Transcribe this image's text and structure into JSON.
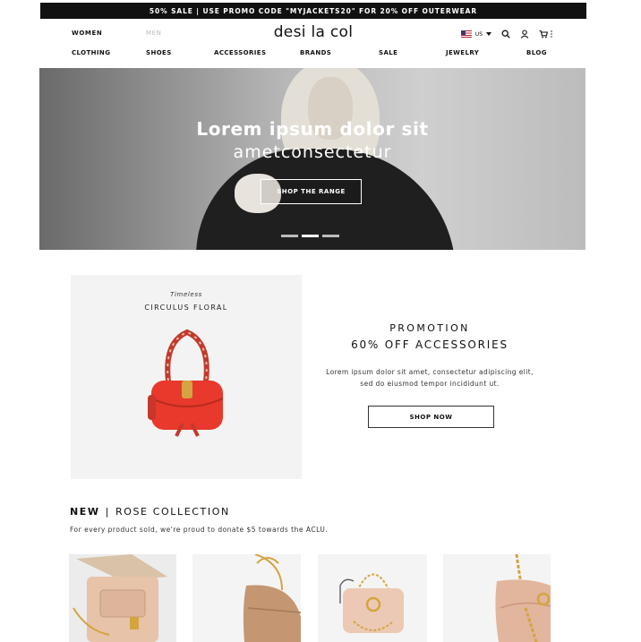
{
  "promo_bar": {
    "text": "50% SALE  |  USE PROMO CODE \"MYJACKETS20\" FOR 20% OFF OUTERWEAR"
  },
  "header": {
    "gender_tabs": [
      "WOMEN",
      "MEN"
    ],
    "logo": "desi la col",
    "region": "US",
    "nav": [
      "CLOTHING",
      "SHOES",
      "ACCESSORIES",
      "BRANDS",
      "SALE",
      "JEWELRY",
      "BLOG"
    ]
  },
  "hero": {
    "title": "Lorem ipsum dolor sit",
    "subtitle": "ametconsectetur",
    "cta": "SHOP THE RANGE",
    "slide_count": 3,
    "active_slide": 2
  },
  "promo_card": {
    "eyebrow": "Timeless",
    "title": "CIRCULUS FLORAL"
  },
  "promotion": {
    "title": "PROMOTION",
    "subtitle": "60% OFF ACCESSORIES",
    "body": "Lorem ipsum dolor sit amet, consectetur adipiscing elit, sed do eiusmod tempor incididunt ut.",
    "cta": "SHOP NOW"
  },
  "collection": {
    "label_new": "NEW",
    "label_name": "ROSE COLLECTION",
    "note": "For every product sold, we're proud to donate $5 towards the ACLU."
  },
  "colors": {
    "bag_red": "#e8392c",
    "nude": "#e7c3aa",
    "tan": "#c49672",
    "gold": "#d4a440"
  },
  "icons": [
    "us-flag-icon",
    "chevron-down-icon",
    "search-icon",
    "user-icon",
    "cart-icon"
  ]
}
